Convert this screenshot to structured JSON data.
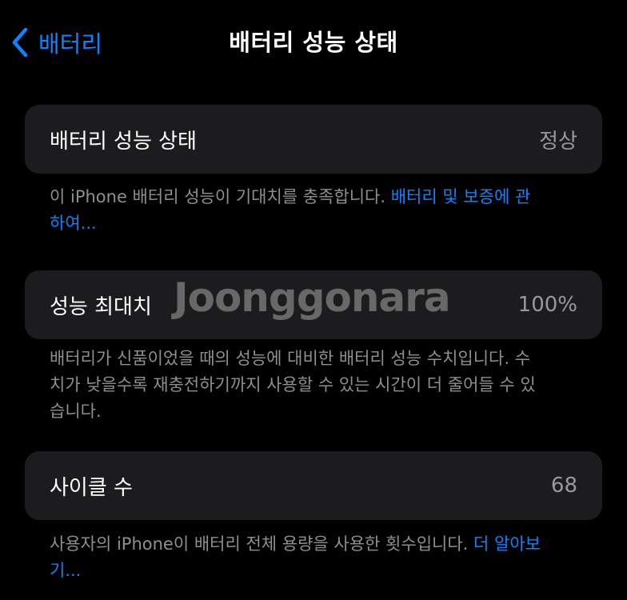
{
  "nav": {
    "back_label": "배터리",
    "title": "배터리 성능 상태"
  },
  "sections": [
    {
      "label": "배터리 성능 상태",
      "value": "정상",
      "footer_text": "이 iPhone 배터리 성능이 기대치를 충족합니다. ",
      "footer_link": "배터리 및 보증에 관하여..."
    },
    {
      "label": "성능 최대치",
      "value": "100%",
      "footer_text": "배터리가 신품이었을 때의 성능에 대비한 배터리 성능 수치입니다. 수치가 낮을수록 재충전하기까지 사용할 수 있는 시간이 더 줄어들 수 있습니다.",
      "footer_link": ""
    },
    {
      "label": "사이클 수",
      "value": "68",
      "footer_text": "사용자의 iPhone이 배터리 전체 용량을 사용한 횟수입니다. ",
      "footer_link": "더 알아보기..."
    }
  ],
  "watermark": "Joonggonara",
  "colors": {
    "background": "#000000",
    "card": "#1c1c1e",
    "accent": "#0a84ff",
    "secondary_text": "#8e8e93"
  },
  "icons": {
    "back": "chevron-left-icon"
  }
}
